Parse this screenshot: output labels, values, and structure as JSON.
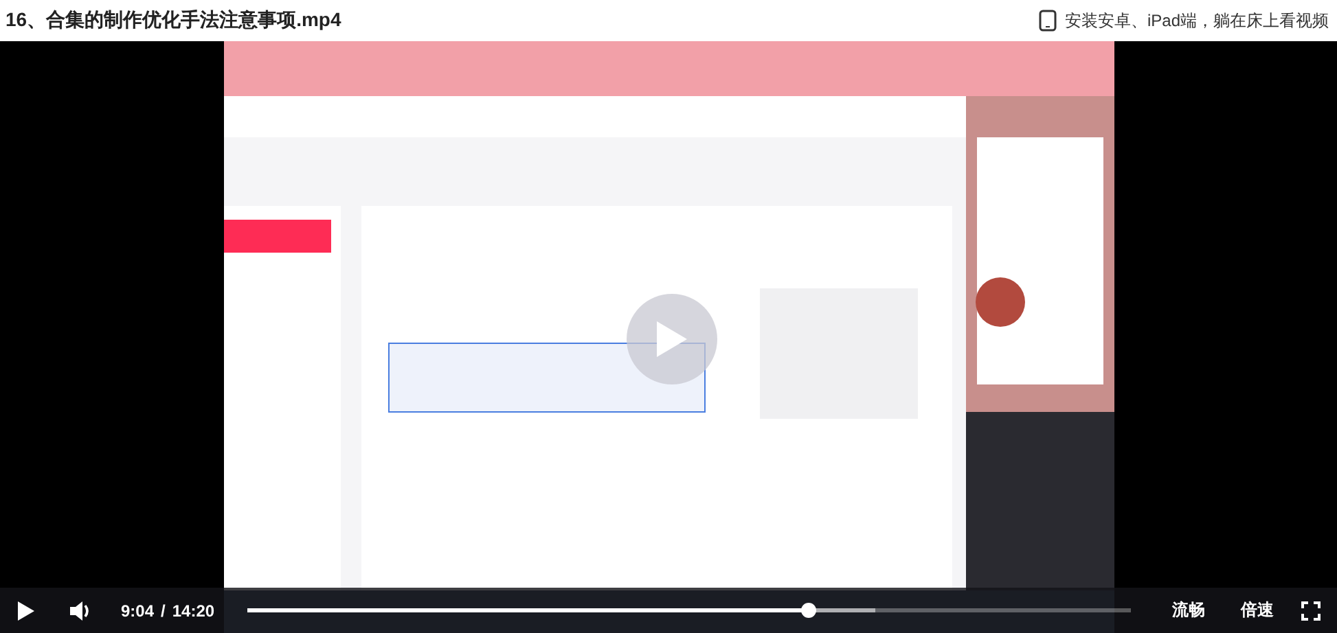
{
  "title": "16、合集的制作优化手法注意事项.mp4",
  "app_link": {
    "label": "安装安卓、iPad端，躺在床上看视频"
  },
  "video": {
    "kind": "picture",
    "paused": true
  },
  "controls": {
    "playing": false,
    "current_time": "9:04",
    "separator": "/",
    "duration": "14:20",
    "progress": {
      "level": 0.634
    },
    "buffered": {
      "level": 0.71
    },
    "quality": "流畅",
    "speed": "倍速"
  }
}
